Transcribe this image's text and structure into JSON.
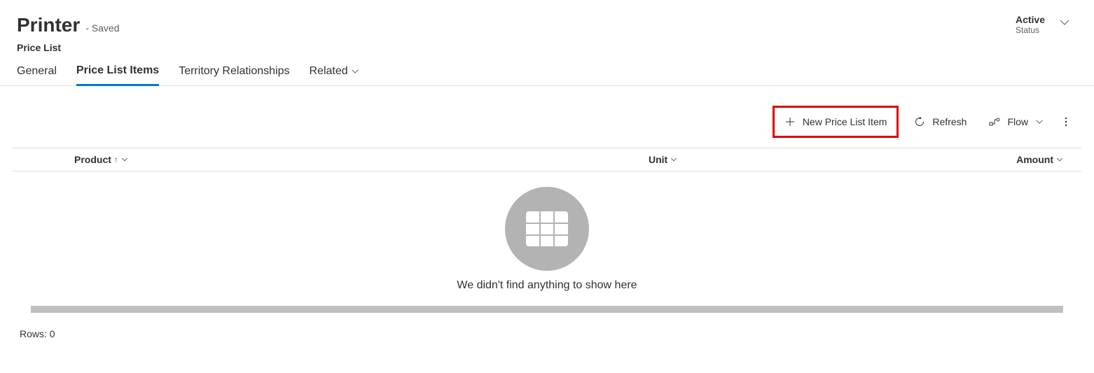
{
  "header": {
    "title": "Printer",
    "saved_label": "- Saved",
    "subtitle": "Price List",
    "status": {
      "value": "Active",
      "label": "Status"
    }
  },
  "tabs": {
    "general": "General",
    "price_list_items": "Price List Items",
    "territory": "Territory Relationships",
    "related": "Related"
  },
  "toolbar": {
    "new_item": "New Price List Item",
    "refresh": "Refresh",
    "flow": "Flow"
  },
  "columns": {
    "product": "Product",
    "unit": "Unit",
    "amount": "Amount"
  },
  "empty": {
    "message": "We didn't find anything to show here"
  },
  "footer": {
    "rows_label": "Rows: 0"
  }
}
